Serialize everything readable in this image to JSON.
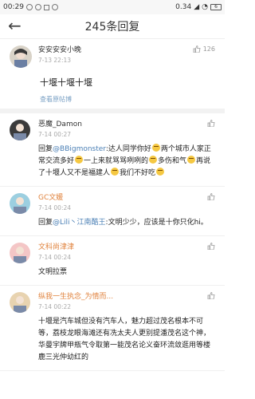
{
  "status": {
    "time": "00:29",
    "speed": "0.34",
    "battery": "6"
  },
  "header": {
    "title": "245条回复"
  },
  "post": {
    "username": "安安安安小晚",
    "time": "7-13 22:13",
    "likes": "126",
    "content": "十堰十堰十堰",
    "view_link": "查看原帖博"
  },
  "comments": [
    {
      "username": "恶魔_Damon",
      "username_color": "#333333",
      "time": "7-14 00:27",
      "segments": [
        {
          "t": "回复"
        },
        {
          "m": "@BBigmonster"
        },
        {
          "t": ":达人同学你好"
        },
        {
          "e": "smile"
        },
        {
          "t": "两个城市人家正常交流多好"
        },
        {
          "e": "smile"
        },
        {
          "t": "一上来就骂骂咧咧的"
        },
        {
          "e": "smile"
        },
        {
          "t": "多伤和气"
        },
        {
          "e": "smile"
        },
        {
          "t": "再说了十堰人又不是福建人"
        },
        {
          "e": "smile"
        },
        {
          "t": "我们不好吃"
        },
        {
          "e": "smile"
        }
      ]
    },
    {
      "username": "GC文媛",
      "username_color": "#e0823c",
      "time": "7-14 00:24",
      "segments": [
        {
          "t": "回复"
        },
        {
          "m": "@Lili丶江南酷王"
        },
        {
          "t": ":文明少少，应该是十你只化hi。"
        }
      ]
    },
    {
      "username": "文科尚津津",
      "username_color": "#e0823c",
      "time": "7-14 00:24",
      "segments": [
        {
          "t": "文明拉票"
        }
      ]
    },
    {
      "username": "纵我一生执念_为情而...",
      "username_color": "#e0823c",
      "time": "7-14 00:22",
      "segments": [
        {
          "t": "十堰是汽车城但没有汽车人，魅力超过茂名根本不可等，荔枝龙眼海滩还有冼太夫人更别提潘茂名这个神，华曼宇牌甲瓶气令取第一能茂名论义奋环流敛逛用等楼鹿三光仲幼红的"
        }
      ]
    }
  ]
}
